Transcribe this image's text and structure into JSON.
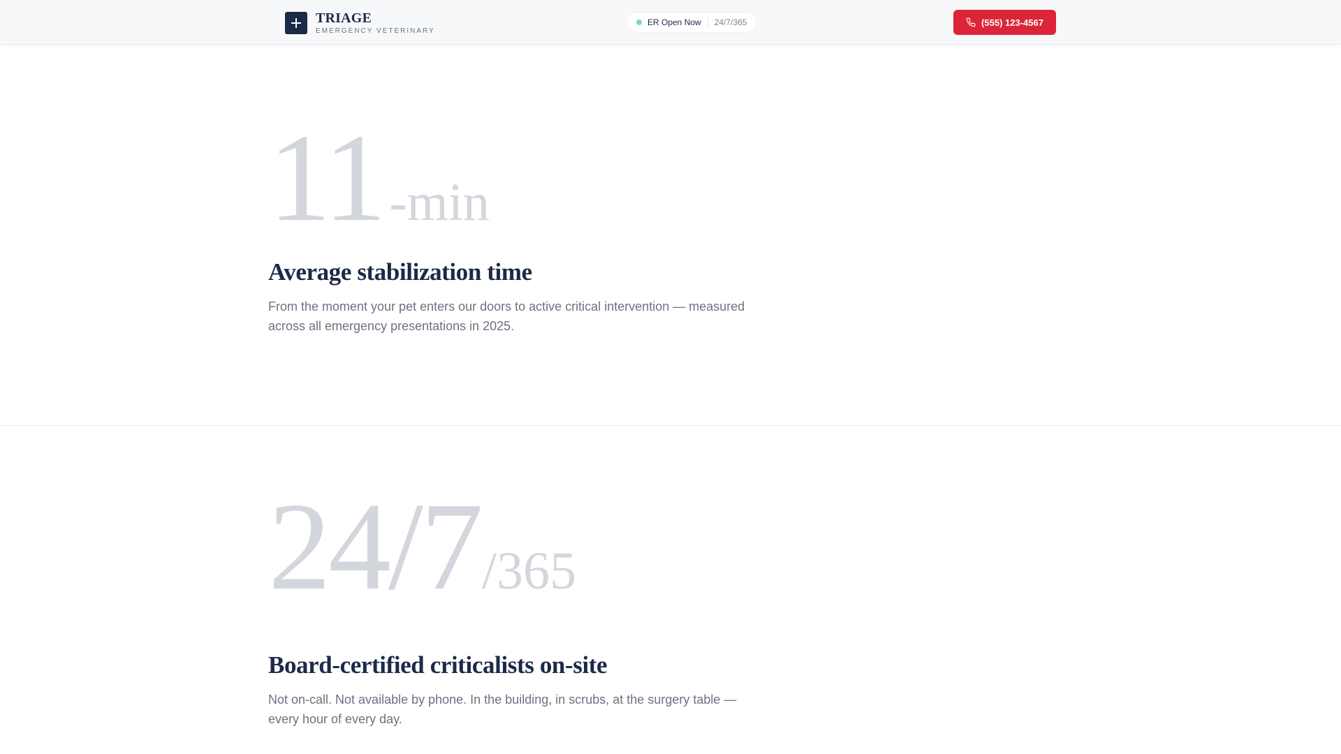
{
  "header": {
    "brand_name": "TRIAGE",
    "brand_tagline": "EMERGENCY VETERINARY",
    "status_label": "ER Open Now",
    "status_hours": "24/7/365",
    "phone_label": "(555) 123-4567",
    "colors": {
      "navy": "#1c2a48",
      "accent_red": "#dc2638",
      "status_green": "#7ddbb4"
    }
  },
  "stats": [
    {
      "number": "11",
      "suffix": "-min",
      "title": "Average stabilization time",
      "description": "From the moment your pet enters our doors to active critical intervention — measured across all emergency presentations in 2025."
    },
    {
      "number": "24/7",
      "suffix": "/365",
      "title": "Board-certified criticalists on-site",
      "description": "Not on-call. Not available by phone. In the building, in scrubs, at the surgery table — every hour of every day."
    }
  ],
  "icons": {
    "logo": "plus-icon",
    "phone": "phone-icon"
  }
}
